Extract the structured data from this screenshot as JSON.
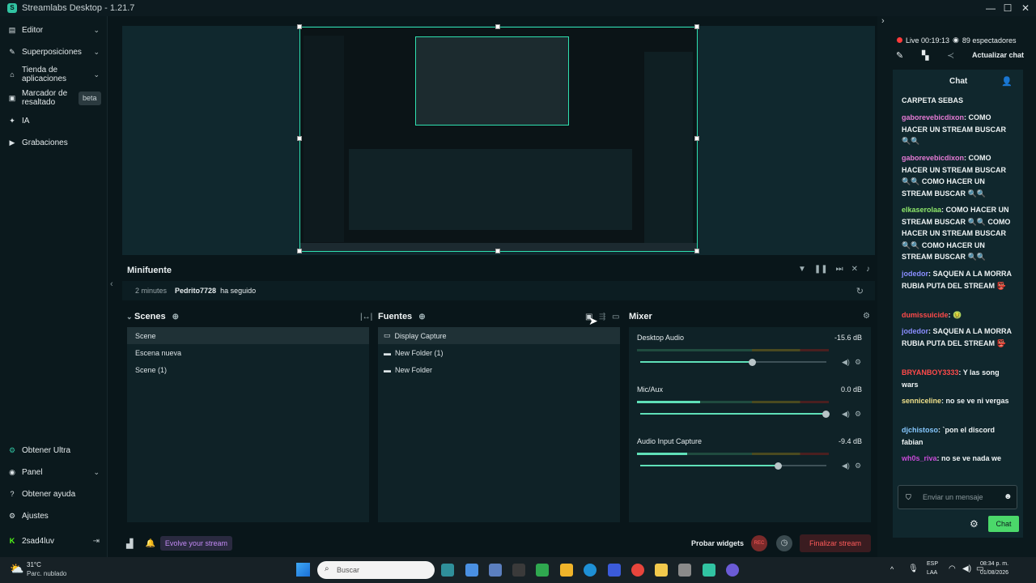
{
  "app": {
    "title": "Streamlabs Desktop - 1.21.7"
  },
  "sidebar": {
    "items": [
      {
        "label": "Editor",
        "icon": "pencil-icon",
        "has_chevron": true
      },
      {
        "label": "Superposiciones",
        "icon": "brush-icon",
        "has_chevron": true
      },
      {
        "label": "Tienda de aplicaciones",
        "icon": "store-icon",
        "has_chevron": true
      },
      {
        "label": "Marcador de resaltado",
        "icon": "highlight-icon",
        "badge": "beta"
      },
      {
        "label": "IA",
        "icon": "sparkle-icon"
      },
      {
        "label": "Grabaciones",
        "icon": "play-icon"
      }
    ],
    "bottom_items": [
      {
        "label": "Obtener Ultra",
        "icon": "ultra-icon"
      },
      {
        "label": "Panel",
        "icon": "panel-icon",
        "has_chevron": true
      },
      {
        "label": "Obtener ayuda",
        "icon": "help-icon"
      },
      {
        "label": "Ajustes",
        "icon": "gear-icon"
      }
    ],
    "user": {
      "name": "2sad4luv",
      "icon": "kick-icon"
    }
  },
  "minifuente": {
    "title": "Minifuente",
    "event": {
      "time": "2 minutes",
      "user": "Pedrito7728",
      "action": "ha seguido"
    }
  },
  "scenes": {
    "title": "Scenes",
    "items": [
      "Scene",
      "Escena nueva",
      "Scene (1)"
    ],
    "selected": 0
  },
  "sources": {
    "title": "Fuentes",
    "items": [
      {
        "label": "Display Capture",
        "icon": "monitor-icon"
      },
      {
        "label": "New Folder (1)",
        "icon": "folder-icon"
      },
      {
        "label": "New Folder",
        "icon": "folder-icon"
      }
    ]
  },
  "mixer": {
    "title": "Mixer",
    "channels": [
      {
        "name": "Desktop Audio",
        "db": "-15.6 dB",
        "level": 0.75,
        "meter": 0.0
      },
      {
        "name": "Mic/Aux",
        "db": "0.0 dB",
        "level": 1.0,
        "meter": 0.33
      },
      {
        "name": "Audio Input Capture",
        "db": "-9.4 dB",
        "level": 0.74,
        "meter": 0.26
      }
    ]
  },
  "bottombar": {
    "evolve": "Evolve your stream",
    "probar": "Probar widgets",
    "rec": "REC",
    "finalizar": "Finalizar stream"
  },
  "live": {
    "status": "Live 00:19:13",
    "viewers": "89 espectadores",
    "refresh_chat": "Actualizar chat"
  },
  "chat": {
    "title": "Chat",
    "input_placeholder": "Enviar un mensaje",
    "send_button": "Chat",
    "messages": [
      {
        "user": "",
        "text": "CARPETA SEBAS",
        "color": "#e8eef0"
      },
      {
        "user": "gaborevebicdixon",
        "text": ": COMO HACER UN STREAM BUSCAR 🔍🔍",
        "color": "#e77bd6"
      },
      {
        "user": "gaborevebicdixon",
        "text": ": COMO HACER UN STREAM BUSCAR 🔍🔍 COMO HACER UN STREAM BUSCAR 🔍🔍",
        "color": "#e77bd6"
      },
      {
        "user": "elkaserolaa",
        "text": ": COMO HACER UN STREAM BUSCAR 🔍🔍 COMO HACER UN STREAM BUSCAR 🔍🔍 COMO HACER UN STREAM BUSCAR 🔍🔍",
        "color": "#8ee86a"
      },
      {
        "user": "jodedor",
        "text": ": SAQUEN A LA MORRA RUBIA PUTA DEL STREAM 👺",
        "color": "#8a8dff"
      },
      {
        "user": "dumissuicide",
        "text": ": 🤢",
        "color": "#ff4a4a"
      },
      {
        "user": "jodedor",
        "text": ": SAQUEN A LA MORRA RUBIA PUTA DEL STREAM 👺",
        "color": "#8a8dff"
      },
      {
        "user": "BRYANBOY3333",
        "text": ": Y las song wars",
        "color": "#ff4a4a"
      },
      {
        "user": "senniceline",
        "text": ": no se ve ni vergas",
        "color": "#f0e08a"
      },
      {
        "user": "djchistoso",
        "text": ": `pon el discord fabian",
        "color": "#86c8ff"
      },
      {
        "user": "wh0s_riva",
        "text": ": no se ve nada we",
        "color": "#c94bd8"
      }
    ]
  },
  "taskbar": {
    "weather_temp": "31°C",
    "weather_desc": "Parc. nublado",
    "search_placeholder": "Buscar",
    "lang1": "ESP",
    "lang2": "LAA",
    "time": "08:34 p. m.",
    "date": "01/08/2026"
  },
  "colors": {
    "accent": "#31c3a2",
    "chat_send": "#4bd86a",
    "finalizar": "#ff5a5a",
    "evolve": "#c38af5"
  }
}
